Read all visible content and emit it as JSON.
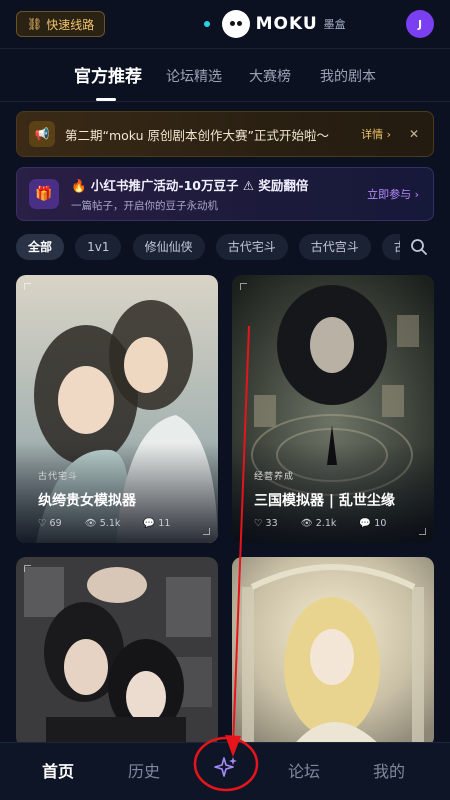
{
  "header": {
    "fast_route_label": "快速线路",
    "brand_name": "MOKU",
    "brand_sub": "墨盒",
    "avatar_initial": "J"
  },
  "tabs": [
    {
      "label": "官方推荐",
      "active": true
    },
    {
      "label": "论坛精选",
      "active": false
    },
    {
      "label": "大赛榜",
      "active": false
    },
    {
      "label": "我的剧本",
      "active": false
    }
  ],
  "banner_contest": {
    "text": "第二期“moku 原创剧本创作大赛”正式开始啦～",
    "more_label": "详情 ›",
    "close_label": "✕"
  },
  "banner_promo": {
    "title": "🔥 小红书推广活动-10万豆子 ⚠ 奖励翻倍",
    "subtitle": "一篇帖子，开启你的豆子永动机",
    "more_label": "立即参与 ›"
  },
  "chips": [
    "全部",
    "1v1",
    "修仙仙侠",
    "古代宅斗",
    "古代宫斗",
    "古色"
  ],
  "cards": [
    {
      "tag": "古代宅斗",
      "title": "纨绔贵女模拟器",
      "likes": "69",
      "views": "5.1k",
      "comments": "11"
    },
    {
      "tag": "经营养成",
      "title": "三国模拟器 | 乱世尘缘",
      "likes": "33",
      "views": "2.1k",
      "comments": "10"
    },
    {
      "tag": "",
      "title": "",
      "likes": "",
      "views": "",
      "comments": ""
    },
    {
      "tag": "",
      "title": "",
      "likes": "",
      "views": "",
      "comments": ""
    }
  ],
  "bottom_nav": [
    {
      "label": "首页",
      "active": true
    },
    {
      "label": "历史",
      "active": false
    },
    {
      "label": "",
      "icon": "sparkle-create-icon"
    },
    {
      "label": "论坛",
      "active": false
    },
    {
      "label": "我的",
      "active": false
    }
  ],
  "colors": {
    "background": "#0b1120",
    "accent_gold": "#f2c46b",
    "accent_purple": "#b78cff",
    "annotation_red": "#e8141c"
  }
}
